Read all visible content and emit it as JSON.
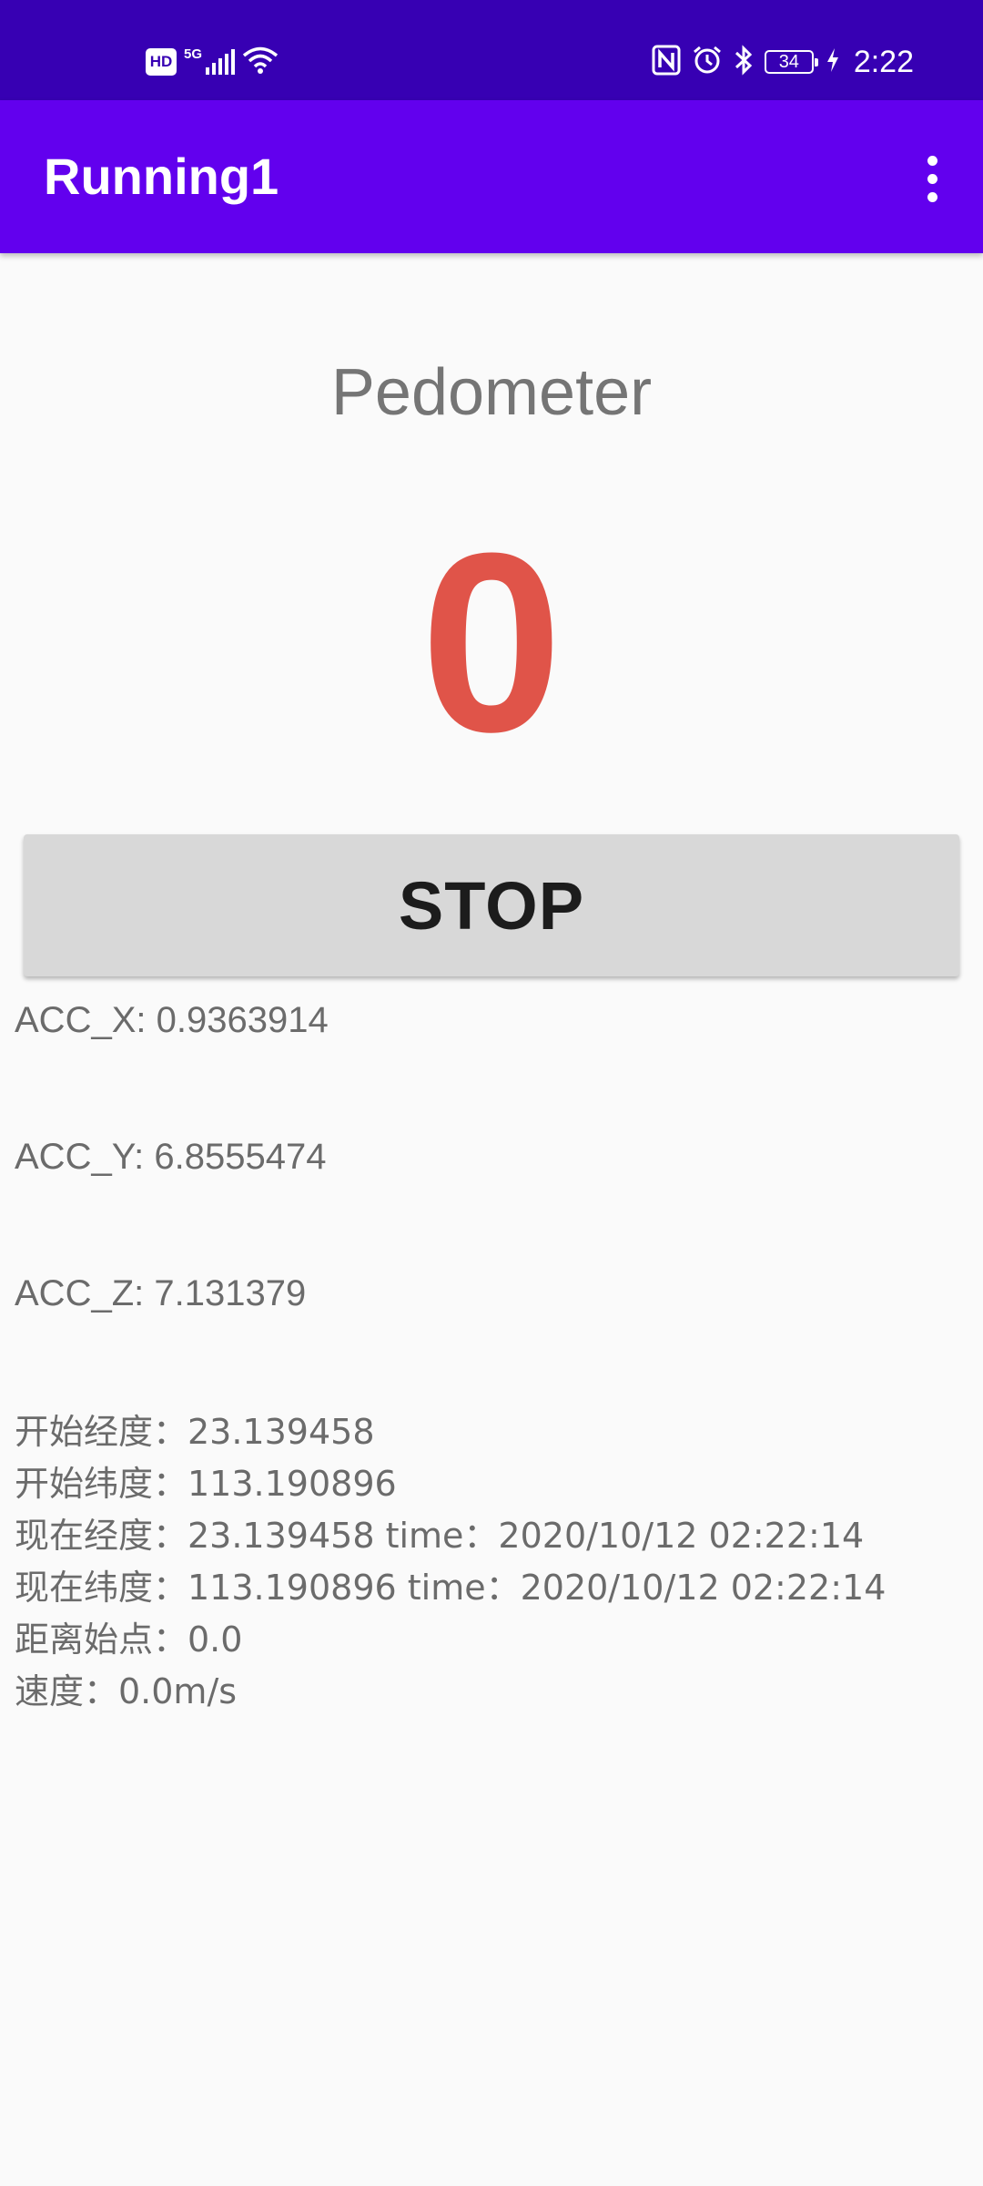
{
  "status_bar": {
    "hd_label": "HD",
    "network_label": "5G",
    "battery_level": "34",
    "time": "2:22",
    "icons": [
      "hd-icon",
      "signal-icon",
      "wifi-icon",
      "nfc-icon",
      "alarm-icon",
      "bluetooth-icon",
      "battery-icon",
      "charging-icon"
    ]
  },
  "app_bar": {
    "title": "Running1",
    "menu_icon": "more-vert-icon"
  },
  "main": {
    "heading": "Pedometer",
    "step_count": "0",
    "stop_button_label": "STOP",
    "acc_x": "ACC_X: 0.9363914",
    "acc_y": "ACC_Y: 6.8555474",
    "acc_z": "ACC_Z: 7.131379",
    "gps": [
      "开始经度：23.139458",
      "开始纬度：113.190896",
      "现在经度：23.139458 time：2020/10/12 02:22:14",
      "现在纬度：113.190896 time：2020/10/12 02:22:14",
      "距离始点：0.0",
      "速度：0.0m/s"
    ]
  },
  "colors": {
    "status_bar_bg": "#3700B3",
    "app_bar_bg": "#6200EE",
    "step_count_color": "#E05449",
    "button_bg": "#D8D8D8",
    "page_bg": "#FAFAFA"
  }
}
